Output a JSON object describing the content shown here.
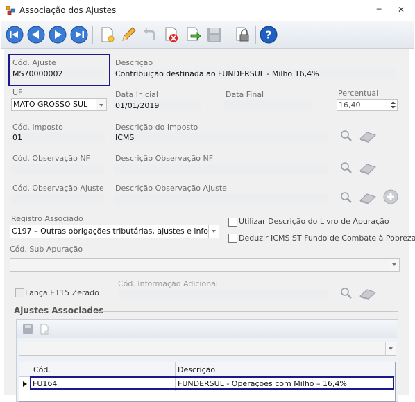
{
  "window": {
    "title": "Associação dos Ajustes",
    "minimize_glyph": "─",
    "close_glyph": "✕"
  },
  "toolbar": {
    "buttons": [
      "first-record-icon",
      "previous-record-icon",
      "next-record-icon",
      "last-record-icon",
      "new-record-icon",
      "edit-icon",
      "undo-icon",
      "delete-icon",
      "confirm-icon",
      "save-icon",
      "lock-icon",
      "help-icon"
    ]
  },
  "form": {
    "cod_ajuste": {
      "label": "Cód. Ajuste",
      "value": "MS70000002"
    },
    "descricao": {
      "label": "Descrição",
      "value": "Contribuição destinada ao FUNDERSUL - Milho 16,4%"
    },
    "uf": {
      "label": "UF",
      "value": "MATO GROSSO SUL"
    },
    "data_inicial": {
      "label": "Data Inicial",
      "value": "01/01/2019"
    },
    "data_final": {
      "label": "Data Final",
      "value": ""
    },
    "percentual": {
      "label": "Percentual",
      "value": "16,40"
    },
    "cod_imposto": {
      "label": "Cód. Imposto",
      "value": "01"
    },
    "descricao_imposto": {
      "label": "Descrição do Imposto",
      "value": "ICMS"
    },
    "cod_obs_nf": {
      "label": "Cód. Observação NF",
      "value": ""
    },
    "descricao_obs_nf": {
      "label": "Descrição Observação NF",
      "value": ""
    },
    "cod_obs_ajuste": {
      "label": "Cód. Observação Ajuste",
      "value": ""
    },
    "descricao_obs_ajuste": {
      "label": "Descrição Observação Ajuste",
      "value": ""
    },
    "registro_associado": {
      "label": "Registro Associado",
      "value": "C197 – Outras obrigações tributárias, ajustes e inform..."
    },
    "utilizar_descricao": {
      "label": "Utilizar Descrição do Livro de Apuração",
      "checked": false
    },
    "deduzir_icms": {
      "label": "Deduzir ICMS ST Fundo de Combate à Pobreza",
      "checked": false
    },
    "cod_sub_apuracao": {
      "label": "Cód. Sub Apuração",
      "value": ""
    },
    "lanca_e115": {
      "label": "Lança E115 Zerado",
      "checked": false
    },
    "cod_info_adicional": {
      "label": "Cód. Informação Adicional",
      "value": ""
    }
  },
  "ajustes_associados": {
    "title": "Ajustes Associados",
    "columns": [
      "Cód.",
      "Descrição"
    ],
    "rows": [
      {
        "cod": "FU164",
        "descricao": "FUNDERSUL - Operações com Milho – 16,4%",
        "current": true
      }
    ]
  },
  "colors": {
    "accent_border": "#1a1a8c",
    "help_blue": "#1f5fbf",
    "delete_red": "#d9241d"
  }
}
